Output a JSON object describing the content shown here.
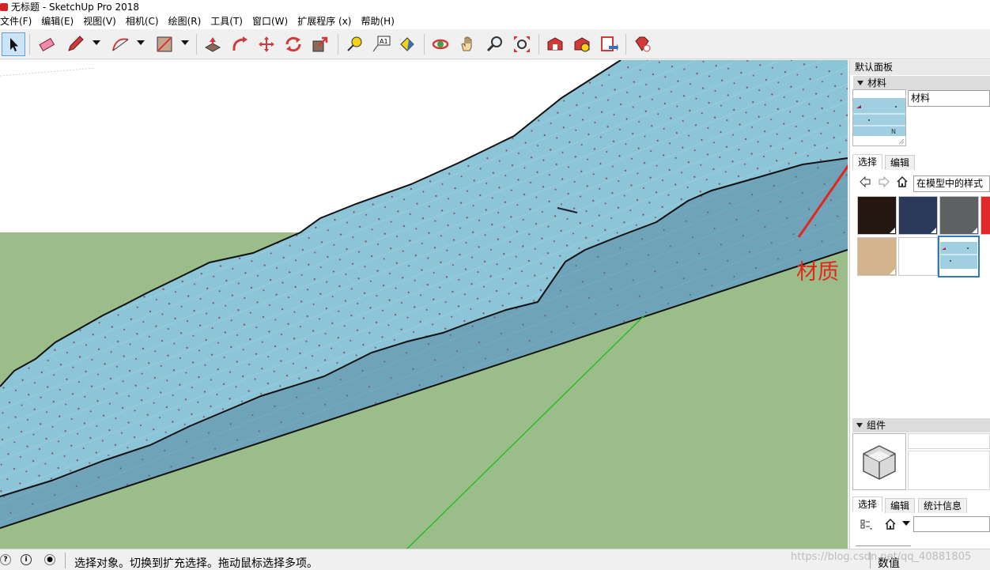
{
  "window": {
    "title": "无标题 - SketchUp Pro 2018"
  },
  "menu": [
    "文件(F)",
    "编辑(E)",
    "视图(V)",
    "相机(C)",
    "绘图(R)",
    "工具(T)",
    "窗口(W)",
    "扩展程序 (x)",
    "帮助(H)"
  ],
  "toolbar": {
    "tools": [
      "select-tool",
      "eraser-tool",
      "pencil-tool",
      "arc-tool",
      "rectangle-tool",
      "push-pull-tool",
      "follow-me-tool",
      "move-tool",
      "rotate-tool",
      "scale-tool",
      "tape-measure-tool",
      "text-tool",
      "paint-bucket-tool",
      "orbit-tool",
      "pan-tool",
      "zoom-tool",
      "zoom-extents-tool",
      "3d-warehouse",
      "extension-warehouse",
      "layout-send",
      "extension-manager"
    ],
    "text_tool_label": "A1",
    "active_tool": "select-tool"
  },
  "viewport": {
    "annotation_label": "材质"
  },
  "tray": {
    "title": "默认面板",
    "materials": {
      "header": "材料",
      "name_value": "材料",
      "tabs": [
        "选择",
        "编辑"
      ],
      "active_tab": "选择",
      "collection": "在模型中的样式",
      "swatches": [
        {
          "name": "dark-brown",
          "color": "#241610"
        },
        {
          "name": "navy",
          "color": "#2b3a5b"
        },
        {
          "name": "gray",
          "color": "#5f6061"
        },
        {
          "name": "red",
          "color": "#e0282a"
        },
        {
          "name": "tan",
          "color": "#d3b48c"
        },
        {
          "name": "white",
          "color": "#ffffff"
        },
        {
          "name": "ground-texture",
          "color": "#9fcfe0"
        }
      ],
      "selected_swatch": "ground-texture"
    },
    "components": {
      "header": "组件",
      "tabs": [
        "选择",
        "编辑",
        "统计信息"
      ],
      "active_tab": "选择"
    }
  },
  "statusbar": {
    "message": "选择对象。切换到扩充选择。拖动鼠标选择多项。",
    "vcb_label": "数值"
  },
  "watermark": "https://blog.csdn.net/qq_40881805",
  "colors": {
    "sky": "#ffffff",
    "ground": "#9bbd8a",
    "surface": "#8cc4d8",
    "accent": "#e0281e",
    "selection": "#2e7bc2"
  }
}
